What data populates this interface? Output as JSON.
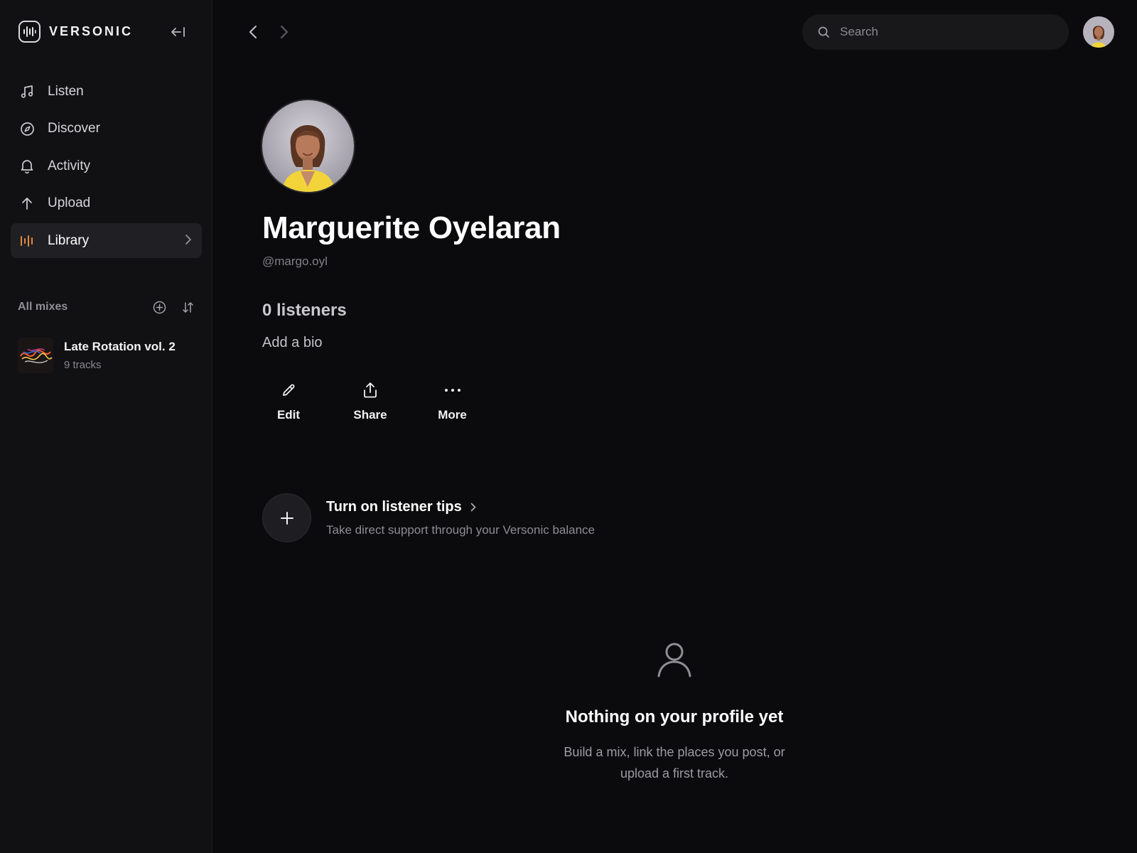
{
  "brand": {
    "name": "VERSONIC"
  },
  "nav": {
    "items": [
      {
        "label": "Listen",
        "icon": "music-note-icon"
      },
      {
        "label": "Discover",
        "icon": "compass-icon"
      },
      {
        "label": "Activity",
        "icon": "bell-icon"
      },
      {
        "label": "Upload",
        "icon": "arrow-up-icon"
      },
      {
        "label": "Library",
        "icon": "waveform-icon",
        "active": true
      }
    ]
  },
  "mixes": {
    "title": "All mixes",
    "items": [
      {
        "title": "Late Rotation vol. 2",
        "subtitle": "9 tracks"
      }
    ]
  },
  "search": {
    "placeholder": "Search"
  },
  "profile": {
    "name": "Marguerite Oyelaran",
    "handle": "@margo.oyl",
    "listeners": "0 listeners",
    "bio_cta": "Add a bio"
  },
  "actions": {
    "edit": "Edit",
    "share": "Share",
    "more": "More"
  },
  "tips": {
    "title": "Turn on listener tips",
    "subtitle": "Take direct support through your Versonic balance"
  },
  "empty_state": {
    "title": "Nothing on your profile yet",
    "line1": "Build a mix, link the places you post, or",
    "line2": "upload a first track."
  },
  "colors": {
    "background": "#0b0b0d",
    "sidebar": "#111113",
    "accent_orange": "#e08a3c",
    "avatar_yellow": "#f2d43a"
  }
}
